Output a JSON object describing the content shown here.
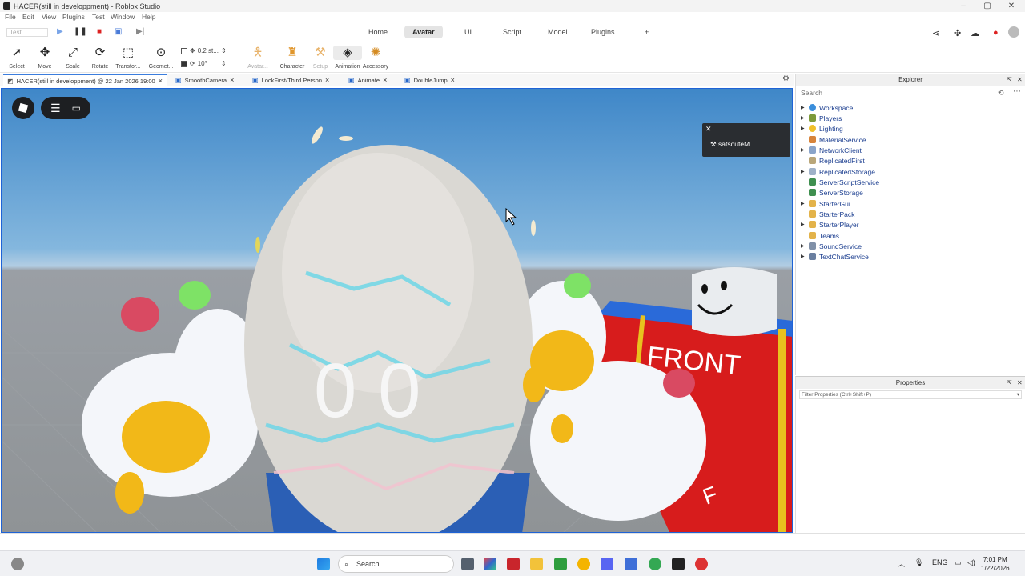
{
  "window": {
    "title": "HACER(still in developpment) - Roblox Studio",
    "controls": [
      "–",
      "▢",
      "✕"
    ]
  },
  "menu": [
    "File",
    "Edit",
    "View",
    "Plugins",
    "Test",
    "Window",
    "Help"
  ],
  "quick": {
    "test_label": "Test"
  },
  "ribbon_tabs": [
    "Home",
    "Avatar",
    "UI",
    "Script",
    "Model",
    "Plugins",
    "+"
  ],
  "tools": {
    "select": "Select",
    "move": "Move",
    "scale": "Scale",
    "rotate": "Rotate",
    "transform": "Transfor...",
    "geometry": "Geomet...",
    "snap_move": "0.2 st...",
    "snap_rotate": "10°",
    "avatar": "Avatar...",
    "character": "Character",
    "setup": "Setup",
    "animation": "Animation",
    "accessory": "Accessory"
  },
  "doc_tabs": [
    "HACER(still in developpment) @ 22 Jan 2026 19:00",
    "SmoothCamera",
    "LockFirst/Third Person",
    "Animate",
    "DoubleJump"
  ],
  "viewport": {
    "notification": "safsoufeM",
    "scene_text": {
      "eyes": "0 0",
      "sign": "FRONT",
      "sign_letter": "F"
    }
  },
  "explorer": {
    "title": "Explorer",
    "search_placeholder": "Search",
    "items": [
      "Workspace",
      "Players",
      "Lighting",
      "MaterialService",
      "NetworkClient",
      "ReplicatedFirst",
      "ReplicatedStorage",
      "ServerScriptService",
      "ServerStorage",
      "StarterGui",
      "StarterPack",
      "StarterPlayer",
      "Teams",
      "SoundService",
      "TextChatService"
    ]
  },
  "properties": {
    "title": "Properties",
    "filter_placeholder": "Filter Properties (Ctrl+Shift+P)"
  },
  "taskbar": {
    "search": "Search",
    "lang": "ENG",
    "time": "7:01 PM",
    "date": "1/22/2026"
  },
  "colors": {
    "accent": "#1e63d6",
    "sky": "#3f87c8",
    "sign_red": "#d71c1c",
    "sign_blue": "#2a6ad9"
  }
}
